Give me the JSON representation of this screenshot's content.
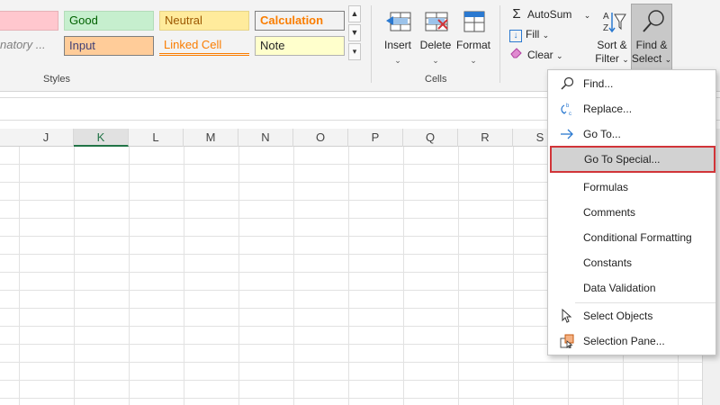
{
  "ribbon": {
    "styles": {
      "group_label": "Styles",
      "cells": [
        {
          "text": "",
          "bg": "#ffc7ce",
          "fg": "#9c0006"
        },
        {
          "text": "Good",
          "bg": "#c6efce",
          "fg": "#006100"
        },
        {
          "text": "Neutral",
          "bg": "#ffeb9c",
          "fg": "#9c5700"
        },
        {
          "text": "Calculation",
          "bg": "#f2f2f2",
          "fg": "#fa7d00"
        },
        {
          "text": "natory ...",
          "bg": "#f3f3f3",
          "fg": "#7f7f7f"
        },
        {
          "text": "Input",
          "bg": "#ffcc99",
          "fg": "#3f3f76"
        },
        {
          "text": "Linked Cell",
          "bg": "#ffffff",
          "fg": "#fa7d00"
        },
        {
          "text": "Note",
          "bg": "#ffffcc",
          "fg": "#262626"
        }
      ],
      "gallery_up": "▲",
      "gallery_down": "▼",
      "gallery_more": "▾"
    },
    "cells_group": {
      "group_label": "Cells",
      "insert_label": "Insert",
      "delete_label": "Delete",
      "format_label": "Format",
      "chevron": "⌄"
    },
    "editing": {
      "autosum_label": "AutoSum",
      "fill_label": "Fill",
      "clear_label": "Clear",
      "sort_filter_label_1": "Sort &",
      "sort_filter_label_2": "Filter",
      "find_select_label_1": "Find &",
      "find_select_label_2": "Select",
      "chevron": "⌄",
      "sigma": "Σ",
      "fill_arrow": "↓"
    }
  },
  "grid": {
    "columns": [
      "J",
      "K",
      "L",
      "M",
      "N",
      "O",
      "P",
      "Q",
      "R",
      "S"
    ],
    "selected_column": "K"
  },
  "menu": {
    "items": [
      {
        "label": "Find...",
        "icon": "search-icon"
      },
      {
        "label": "Replace...",
        "icon": "replace-icon"
      },
      {
        "label": "Go To...",
        "icon": "arrow-right-icon"
      },
      {
        "label": "Go To Special...",
        "icon": "",
        "highlighted": true
      },
      {
        "label": "Formulas",
        "icon": ""
      },
      {
        "label": "Comments",
        "icon": ""
      },
      {
        "label": "Conditional Formatting",
        "icon": ""
      },
      {
        "label": "Constants",
        "icon": ""
      },
      {
        "label": "Data Validation",
        "icon": ""
      },
      {
        "label": "Select Objects",
        "icon": "pointer-icon"
      },
      {
        "label": "Selection Pane...",
        "icon": "selection-pane-icon"
      }
    ]
  },
  "colors": {
    "highlight_border": "#d13438",
    "selected_header": "#217346",
    "accent_blue": "#2b79d0"
  }
}
